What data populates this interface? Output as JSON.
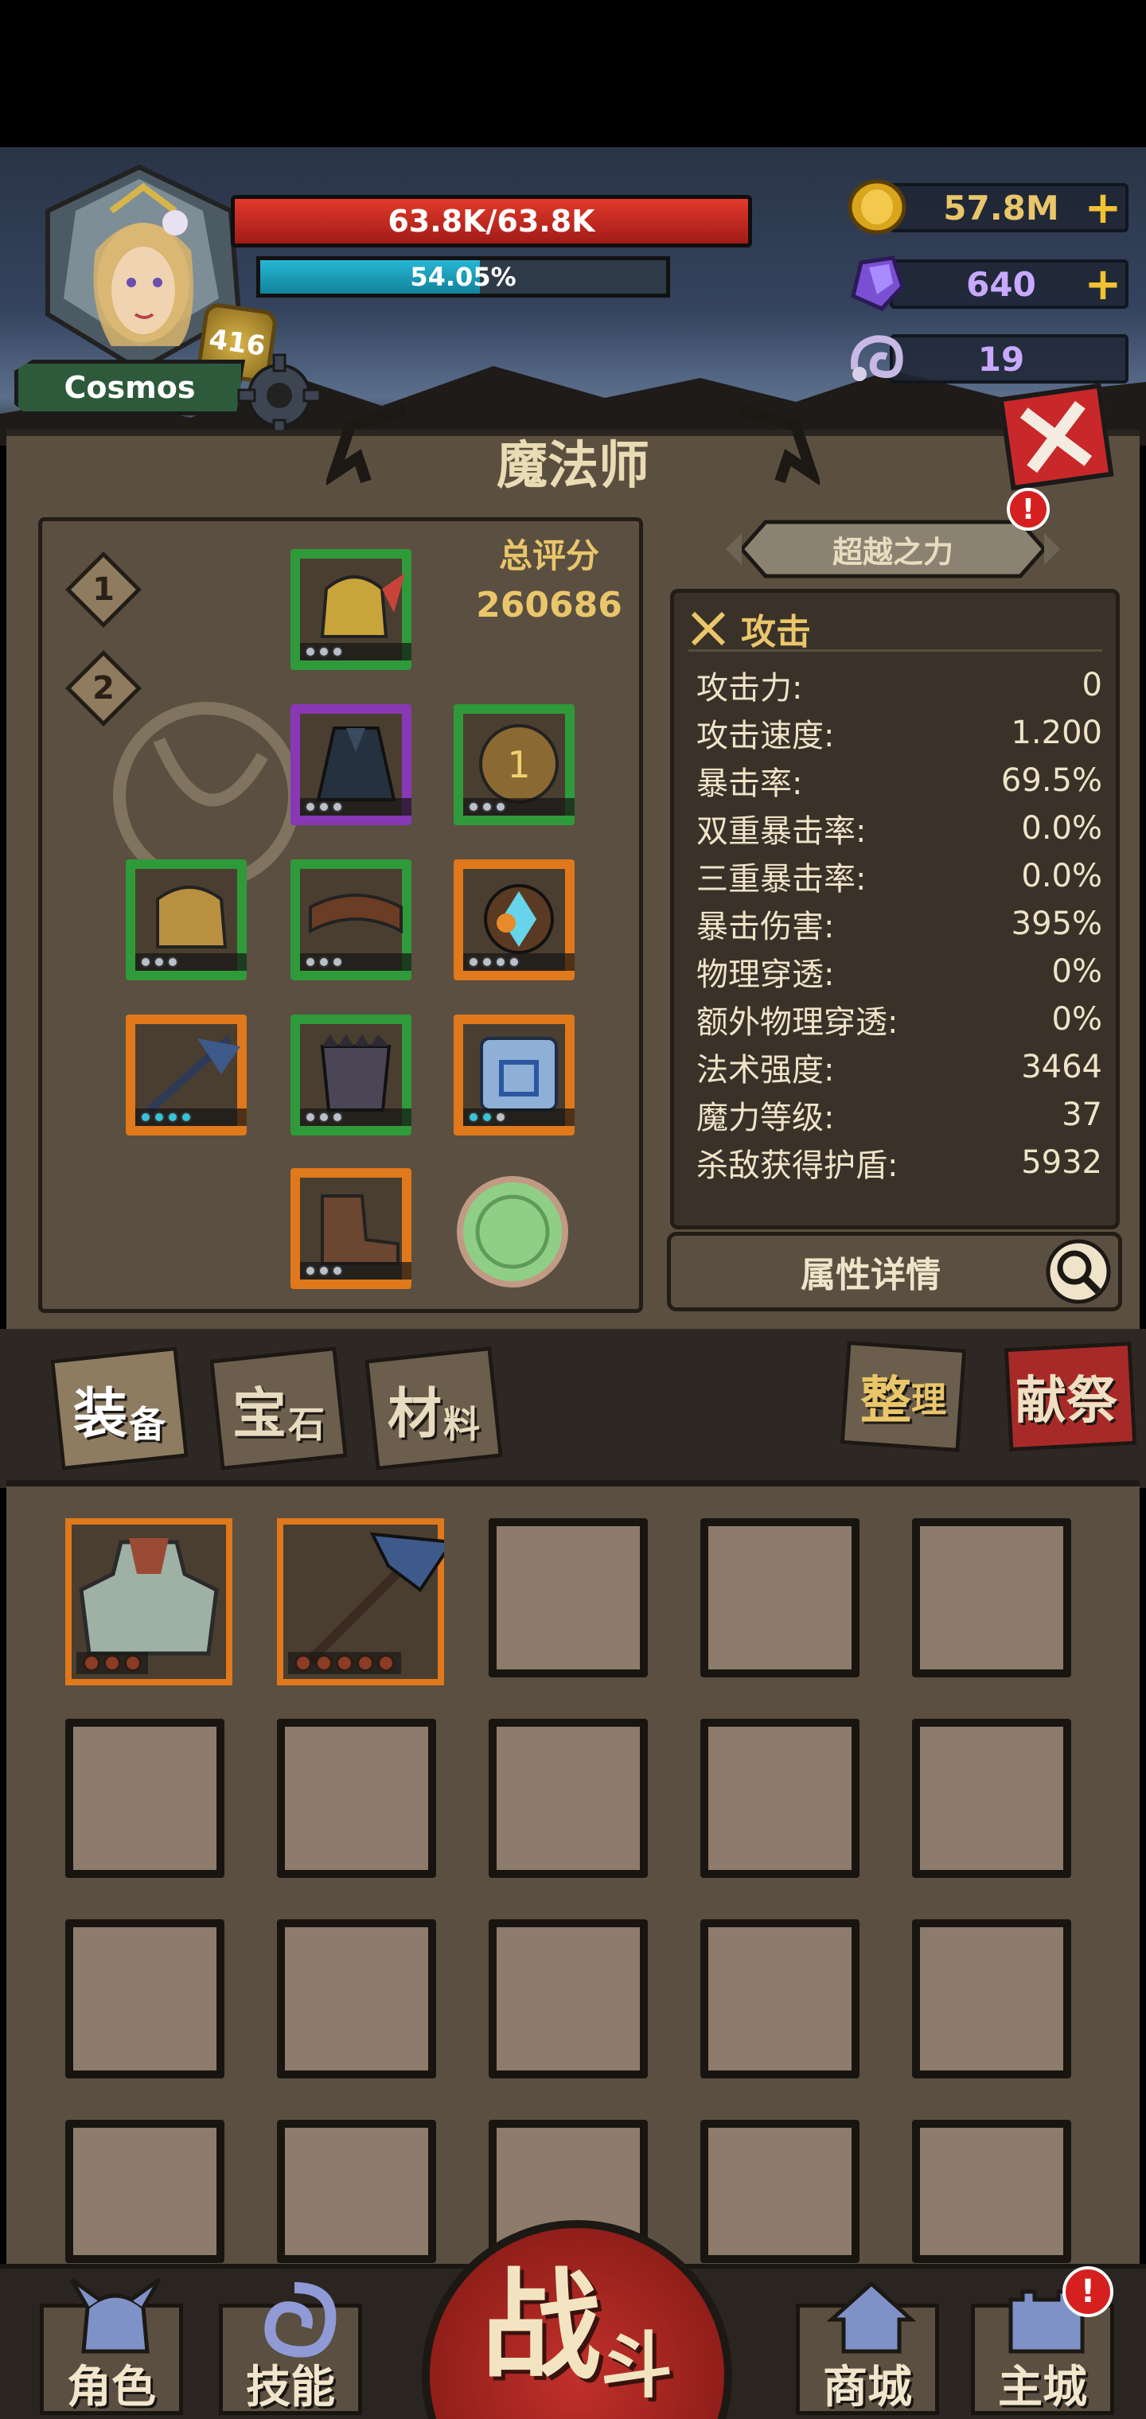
{
  "player": {
    "name": "Cosmos",
    "level": "416",
    "hp_text": "63.8K/63.8K",
    "hp_fraction": 1.0,
    "xp_text": "54.05%",
    "xp_fraction": 0.5405
  },
  "currency": {
    "gold": "57.8M",
    "gems": "640",
    "keys": "19",
    "plus": "+"
  },
  "panel": {
    "class_title": "魔法师",
    "total_score_label": "总评分",
    "total_score_value": "260686",
    "loadout_tabs": [
      "1",
      "2"
    ],
    "transcend_label": "超越之力",
    "notice": "!"
  },
  "stats": {
    "section_title": "攻击",
    "rows": [
      {
        "label": "攻击力:",
        "value": "0"
      },
      {
        "label": "攻击速度:",
        "value": "1.200"
      },
      {
        "label": "暴击率:",
        "value": "69.5%"
      },
      {
        "label": "双重暴击率:",
        "value": "0.0%"
      },
      {
        "label": "三重暴击率:",
        "value": "0.0%"
      },
      {
        "label": "暴击伤害:",
        "value": "395%"
      },
      {
        "label": "物理穿透:",
        "value": "0%"
      },
      {
        "label": "额外物理穿透:",
        "value": "0%"
      },
      {
        "label": "法术强度:",
        "value": "3464"
      },
      {
        "label": "魔力等级:",
        "value": "37"
      },
      {
        "label": "杀敌获得护盾:",
        "value": "5932"
      }
    ],
    "detail_button": "属性详情"
  },
  "tabs": {
    "equip": {
      "big": "装",
      "small": "备"
    },
    "gems": {
      "big": "宝",
      "small": "石"
    },
    "materials": {
      "big": "材",
      "small": "料"
    },
    "sort": {
      "big": "整",
      "small": "理"
    },
    "offer": "献祭"
  },
  "nav": {
    "role": "角色",
    "skills": "技能",
    "battle_big": "战",
    "battle_small": "斗",
    "shop": "商城",
    "main_city": "主城",
    "notice": "!"
  },
  "colors": {
    "hp": "#d32b22",
    "xp": "#1ea9c7",
    "gold_text": "#e9c66a",
    "rarity_green": "#2f9a3a",
    "rarity_purple": "#8838b5",
    "rarity_orange": "#e0781c",
    "offer_red": "#a82a28"
  },
  "icons": {
    "gold": "gold-coin-icon",
    "gems": "purple-crystal-icon",
    "keys": "ram-horn-key-icon",
    "settings": "gear-icon",
    "close": "close-icon",
    "search": "magnifier-icon"
  }
}
